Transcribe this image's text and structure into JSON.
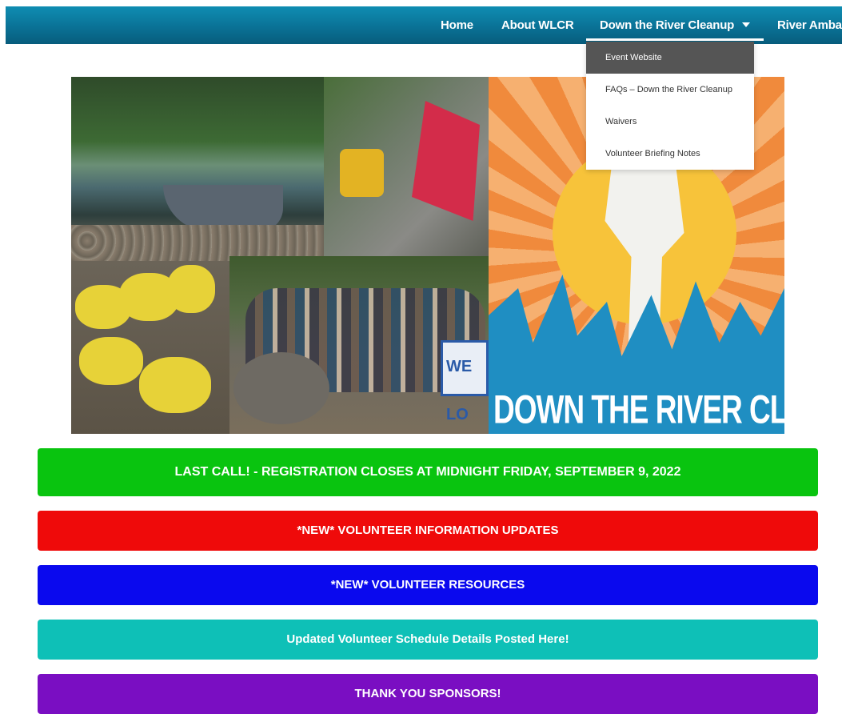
{
  "nav": {
    "items": [
      {
        "label": "Home"
      },
      {
        "label": "About WLCR"
      },
      {
        "label": "Down the River Cleanup"
      },
      {
        "label": "River Ambas"
      }
    ],
    "dropdown": {
      "items": [
        {
          "label": "Event Website"
        },
        {
          "label": "FAQs – Down the River Cleanup"
        },
        {
          "label": "Waivers"
        },
        {
          "label": "Volunteer Briefing Notes"
        }
      ]
    }
  },
  "hero": {
    "poster_title": "DOWN THE RIVER CLEAN UP",
    "banner_text": "WE LO"
  },
  "buttons": {
    "registration": "LAST CALL! - REGISTRATION CLOSES AT MIDNIGHT FRIDAY, SEPTEMBER 9, 2022",
    "info_updates": "*NEW* VOLUNTEER INFORMATION UPDATES",
    "resources": "*NEW* VOLUNTEER RESOURCES",
    "schedule": "Updated Volunteer Schedule Details Posted Here!",
    "sponsors": "THANK YOU SPONSORS!"
  },
  "colors": {
    "nav": "#0a7296",
    "green": "#09c40f",
    "red": "#ef0a0a",
    "blue": "#0a09ee",
    "teal": "#0ec0b7",
    "purple": "#7a0ec2"
  }
}
